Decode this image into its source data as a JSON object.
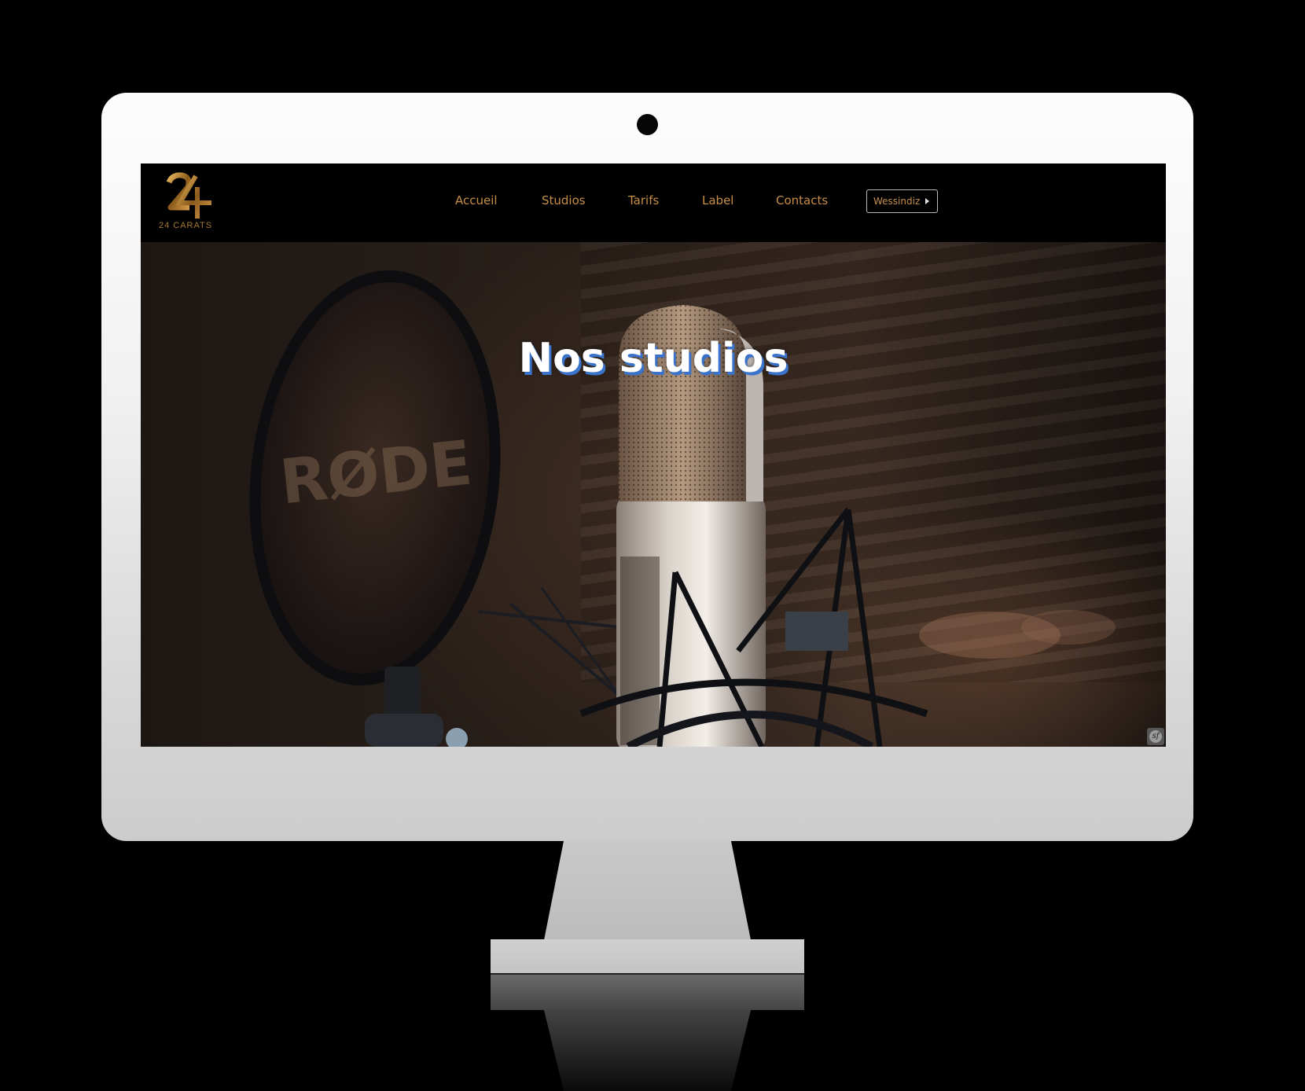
{
  "brand": {
    "logo_mark": "24",
    "logo_text": "24 CARATS"
  },
  "nav": {
    "items": [
      {
        "label": "Accueil"
      },
      {
        "label": "Studios"
      },
      {
        "label": "Tarifs"
      },
      {
        "label": "Label"
      },
      {
        "label": "Contacts"
      }
    ],
    "user_label": "Wessindiz"
  },
  "hero": {
    "title": "Nos studios",
    "mic_brand": "RØDE"
  },
  "colors": {
    "nav_text": "#c78e49",
    "logo_gold": "#b8872f",
    "title_shadow": "#3a73c9",
    "page_background": "#000000"
  },
  "icons": {
    "user_dropdown": "caret-right-icon",
    "debug_toolbar": "symfony-icon"
  }
}
